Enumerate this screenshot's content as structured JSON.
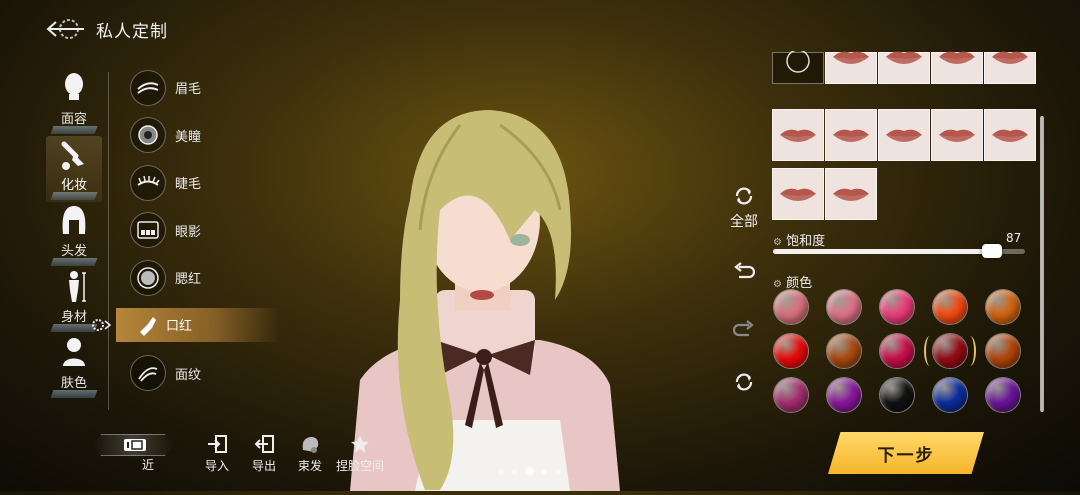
{
  "header": {
    "title": "私人定制"
  },
  "categories": [
    {
      "label": "面容",
      "icon": "face-head-icon",
      "active": false
    },
    {
      "label": "化妆",
      "icon": "makeup-brush-icon",
      "active": true
    },
    {
      "label": "头发",
      "icon": "hair-icon",
      "active": false
    },
    {
      "label": "身材",
      "icon": "body-figure-icon",
      "active": false
    },
    {
      "label": "肤色",
      "icon": "skin-tone-icon",
      "active": false
    }
  ],
  "makeup_items": [
    {
      "label": "眉毛",
      "icon": "eyebrow-icon"
    },
    {
      "label": "美瞳",
      "icon": "iris-icon"
    },
    {
      "label": "睫毛",
      "icon": "eyelash-icon"
    },
    {
      "label": "眼影",
      "icon": "eyeshadow-palette-icon"
    },
    {
      "label": "腮红",
      "icon": "blush-compact-icon"
    },
    {
      "label": "口红",
      "icon": "lipstick-icon",
      "active": true
    },
    {
      "label": "面纹",
      "icon": "face-pattern-icon"
    }
  ],
  "side_controls": {
    "all_label": "全部",
    "icons": [
      "reset-all-icon",
      "undo-icon",
      "redo-icon",
      "random-icon"
    ]
  },
  "lip_presets": {
    "rows": 4,
    "selected_none": "none-option-icon",
    "lip_color": "#b5574d"
  },
  "saturation": {
    "label": "饱和度",
    "value": 87,
    "max": 100
  },
  "color": {
    "label": "颜色",
    "swatches": [
      "#d8707d",
      "#dc7288",
      "#ec3c7a",
      "#f24a12",
      "#d2640f",
      "#e80a0a",
      "#a84a12",
      "#c80f4b",
      "#930c15",
      "#b2450a",
      "#a42e70",
      "#8a179c",
      "#111111",
      "#0b2c9e",
      "#6a159a"
    ],
    "selected_index": 8
  },
  "next_button": {
    "label": "下一步"
  },
  "toolbar": {
    "camera_label": "近",
    "tools": [
      {
        "label": "导入",
        "icon": "import-icon"
      },
      {
        "label": "导出",
        "icon": "export-icon"
      },
      {
        "label": "束发",
        "icon": "tie-hair-icon"
      },
      {
        "label": "捏脸空间",
        "icon": "face-space-star-icon"
      }
    ]
  },
  "pager": {
    "count": 5,
    "active_index": 3
  }
}
